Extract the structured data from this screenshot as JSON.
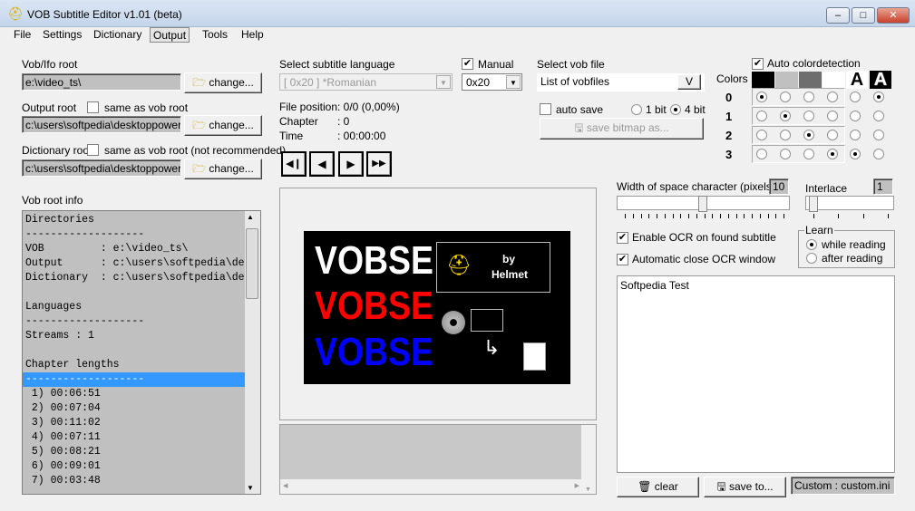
{
  "window": {
    "title": "VOB Subtitle Editor v1.01 (beta)",
    "min": "–",
    "max": "□",
    "close": "✕"
  },
  "menu": [
    "File",
    "Settings",
    "Dictionary",
    "Output",
    "Tools",
    "Help"
  ],
  "roots": {
    "vob_label": "Vob/Ifo root",
    "vob_value": "e:\\video_ts\\",
    "output_label": "Output root",
    "output_same": "same as vob root",
    "output_value": "c:\\users\\softpedia\\desktoppowersc",
    "dict_label": "Dictionary root",
    "dict_same": "same as vob root (not recommended)",
    "dict_value": "c:\\users\\softpedia\\desktoppowersc",
    "change": "change..."
  },
  "info": {
    "label": "Vob root info",
    "lines": [
      "Directories",
      "-------------------",
      "VOB         : e:\\video_ts\\",
      "Output      : c:\\users\\softpedia\\des",
      "Dictionary  : c:\\users\\softpedia\\des",
      "",
      "Languages",
      "-------------------",
      "Streams : 1",
      "",
      "Chapter lengths",
      "-------------------",
      " 1) 00:06:51",
      " 2) 00:07:04",
      " 3) 00:11:02",
      " 4) 00:07:11",
      " 5) 00:08:21",
      " 6) 00:09:01",
      " 7) 00:03:48"
    ],
    "selected_index": 11
  },
  "language": {
    "label": "Select subtitle language",
    "value": "[ 0x20 ] *Romanian",
    "manual_label": "Manual",
    "manual_value": "0x20"
  },
  "position": {
    "file_label": "File position",
    "file_value": ": 0/0  (0,00%)",
    "chapter_label": "Chapter",
    "chapter_value": ": 0",
    "time_label": "Time",
    "time_value": ": 00:00:00"
  },
  "preview": {
    "logo_text": "VOBSE",
    "by": "by",
    "author": "Helmet"
  },
  "vobfile": {
    "label": "Select vob file",
    "value": "List of vobfiles",
    "btn": "V",
    "auto_save": "auto save",
    "bit1": "1 bit",
    "bit4": "4 bit",
    "save_bitmap": "save bitmap as..."
  },
  "colors": {
    "auto_label": "Auto colordetection",
    "label": "Colors",
    "rows": [
      "0",
      "1",
      "2",
      "3"
    ],
    "swatches": [
      "#000000",
      "#c0c0c0",
      "#6e6e6e",
      "#ffffff"
    ],
    "selection": [
      [
        0,
        5
      ],
      [
        1
      ],
      [
        2
      ],
      [
        3,
        4
      ]
    ]
  },
  "space": {
    "label": "Width of space character (pixels)",
    "value": "10",
    "slider_fraction": 0.5
  },
  "interlace": {
    "label": "Interlace",
    "value": "1",
    "slider_fraction": 0
  },
  "ocr": {
    "enable": "Enable OCR on found subtitle",
    "auto_close": "Automatic close OCR window"
  },
  "learn": {
    "label": "Learn",
    "while": "while reading",
    "after": "after reading"
  },
  "output": {
    "text": "Softpedia Test",
    "clear": "clear",
    "save": "save to...",
    "status": "Custom : custom.ini"
  }
}
